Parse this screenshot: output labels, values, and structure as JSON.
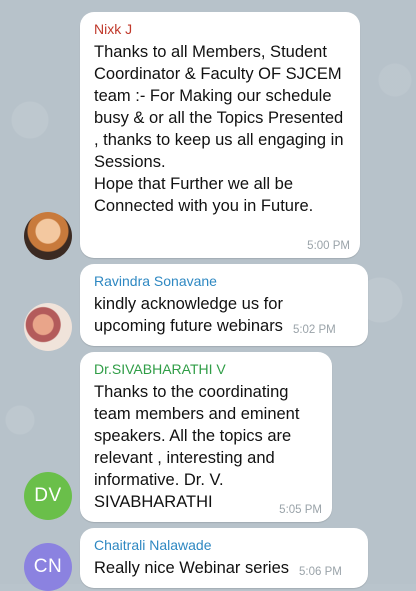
{
  "colors": {
    "sender1": "#c0392b",
    "sender2": "#2e88c2",
    "sender3": "#2f9d46",
    "sender4": "#2e88c2",
    "avatar_dv": "#6abf4a",
    "avatar_cn": "#8b82e0"
  },
  "messages": [
    {
      "sender": "Nixk J",
      "text": "Thanks to all Members, Student Coordinator & Faculty OF SJCEM team :- For Making our schedule busy & or all the Topics Presented , thanks to keep us all engaging in Sessions.\nHope that Further we all be Connected with you in Future.",
      "time": "5:00 PM"
    },
    {
      "sender": "Ravindra Sonavane",
      "text": "kindly acknowledge us for upcoming future webinars",
      "time": "5:02 PM"
    },
    {
      "sender": "Dr.SIVABHARATHI V",
      "text": "Thanks to the coordinating team members and eminent speakers. All the topics are relevant , interesting and informative. Dr. V. SIVABHARATHI",
      "time": "5:05 PM",
      "avatar_initials": "DV"
    },
    {
      "sender": "Chaitrali Nalawade",
      "text": "Really nice Webinar series",
      "time": "5:06 PM",
      "avatar_initials": "CN"
    }
  ]
}
